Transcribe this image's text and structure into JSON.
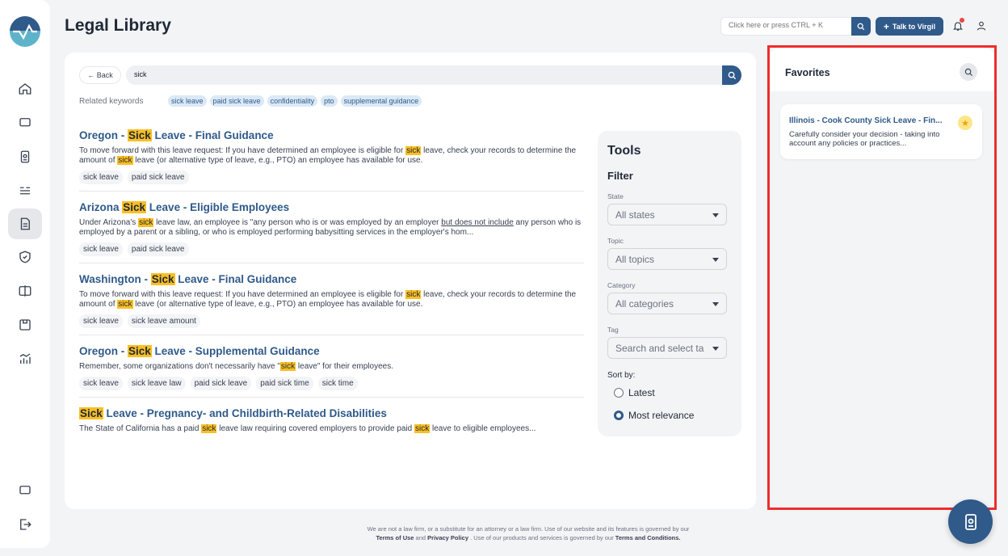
{
  "page": {
    "title": "Legal Library"
  },
  "header": {
    "search_placeholder": "Click here or press CTRL + K",
    "talk_button": "Talk to Virgil",
    "talk_plus": "+"
  },
  "search": {
    "back_label": "← Back",
    "query": "sick",
    "related_label": "Related keywords",
    "keywords": [
      "sick leave",
      "paid sick leave",
      "confidentiality",
      "pto",
      "supplemental guidance"
    ]
  },
  "results": [
    {
      "title_pre": "Oregon - ",
      "title_hl": "Sick",
      "title_post": " Leave - Final Guidance",
      "desc_parts": [
        "To move forward with this leave request: If you have determined an employee is eligible for ",
        "sick",
        " leave, check your records to determine the amount of ",
        "sick",
        " leave (or alternative type of leave, e.g., PTO) an employee has available for use."
      ],
      "tags": [
        "sick leave",
        "paid sick leave"
      ]
    },
    {
      "title_pre": "Arizona ",
      "title_hl": "Sick",
      "title_post": " Leave - Eligible Employees",
      "desc_parts": [
        "Under Arizona's ",
        "sick",
        " leave law, an employee is \"any person who is or was employed by an employer ",
        "but does not include",
        " any person who is employed by a parent or a sibling, or who is employed performing babysitting services in the employer's hom..."
      ],
      "tags": [
        "sick leave",
        "paid sick leave"
      ]
    },
    {
      "title_pre": "Washington - ",
      "title_hl": "Sick",
      "title_post": " Leave - Final Guidance",
      "desc_parts": [
        "To move forward with this leave request: If you have determined an employee is eligible for ",
        "sick",
        " leave, check your records to determine the amount of ",
        "sick",
        " leave (or alternative type of leave, e.g., PTO) an employee has available for use."
      ],
      "tags": [
        "sick leave",
        "sick leave amount"
      ]
    },
    {
      "title_pre": "Oregon - ",
      "title_hl": "Sick",
      "title_post": " Leave - Supplemental Guidance",
      "desc_parts": [
        "Remember, some organizations don't necessarily have \"",
        "sick",
        " leave\" for their employees."
      ],
      "tags": [
        "sick leave",
        "sick leave law",
        "paid sick leave",
        "paid sick time",
        "sick time"
      ]
    },
    {
      "title_pre": "",
      "title_hl": "Sick",
      "title_post": " Leave - Pregnancy- and Childbirth-Related Disabilities",
      "desc_parts": [
        "The State of California has a paid ",
        "sick",
        " leave law requiring covered employers to provide paid ",
        "sick",
        " leave to eligible employees..."
      ],
      "tags": []
    }
  ],
  "tools": {
    "title": "Tools",
    "filter_title": "Filter",
    "state_label": "State",
    "state_value": "All states",
    "topic_label": "Topic",
    "topic_value": "All topics",
    "category_label": "Category",
    "category_value": "All categories",
    "tag_label": "Tag",
    "tag_placeholder": "Search and select ta",
    "sort_label": "Sort by:",
    "sort_latest": "Latest",
    "sort_relevance": "Most relevance"
  },
  "favorites": {
    "title": "Favorites",
    "item_title": "Illinois - Cook County Sick Leave - Fin...",
    "item_desc": "Carefully consider your decision - taking into account any policies or practices..."
  },
  "footer": {
    "line1": "We are not a law firm, or a substitute for an attorney or a law firm. Use of our website and its features is governed by our",
    "terms": "Terms of Use",
    "and": " and ",
    "privacy": "Privacy Policy",
    "line2_mid": " . Use of our products and services is governed by our ",
    "conditions": "Terms and Conditions."
  },
  "colors": {
    "brand": "#2f5a8a",
    "highlight": "#fbbf24",
    "favorites_border": "#ef2d2d"
  }
}
